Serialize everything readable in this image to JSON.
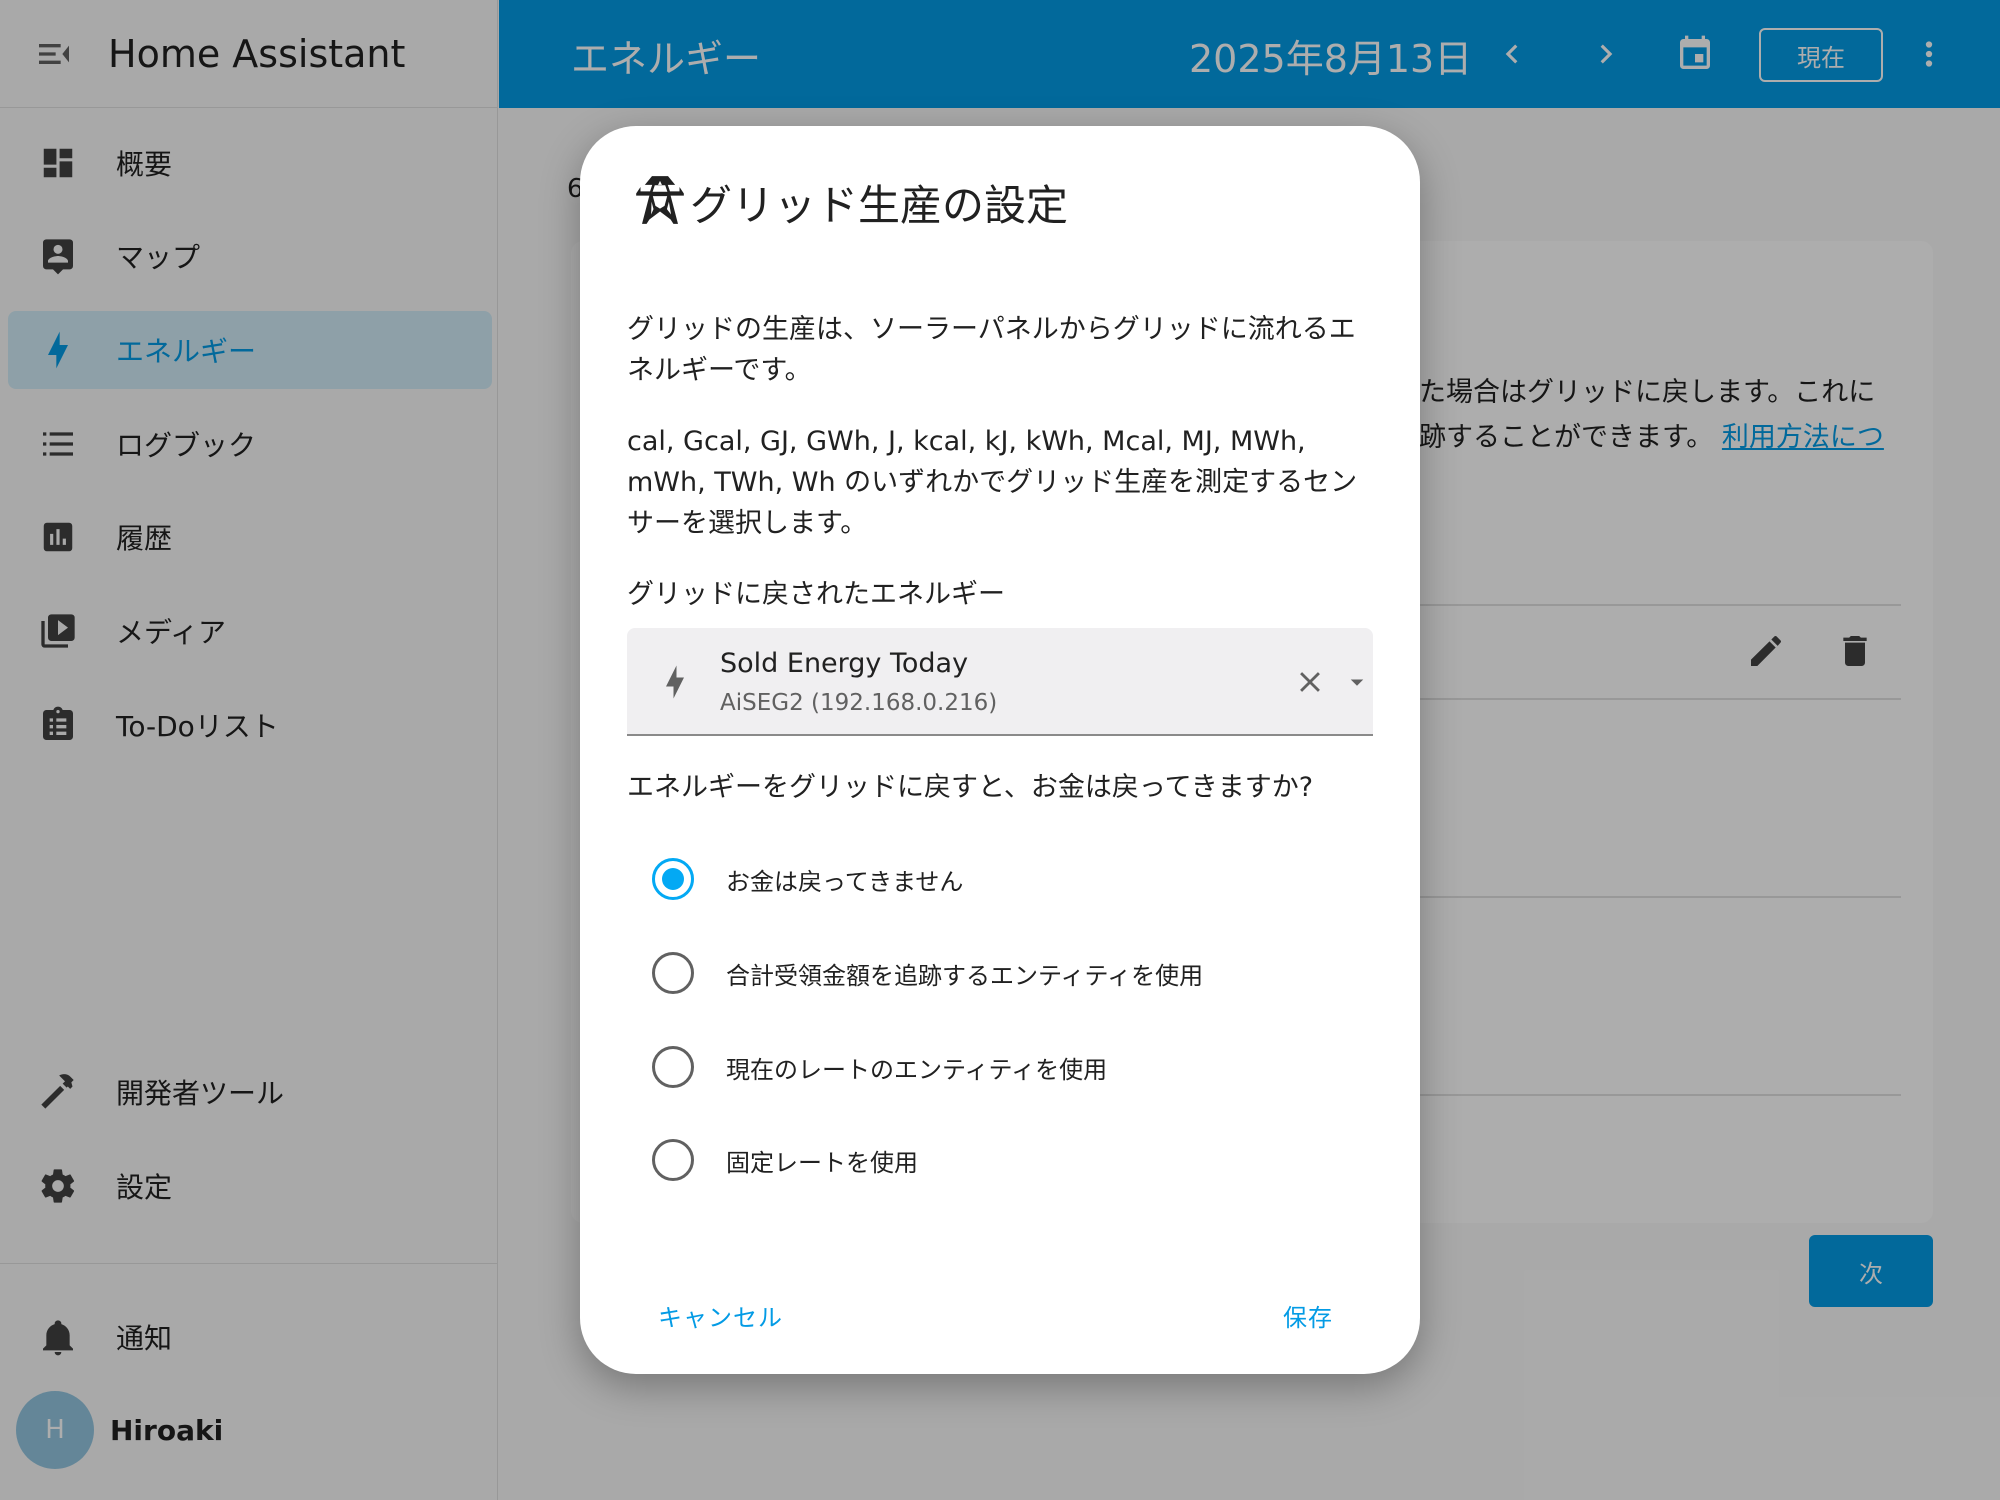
{
  "sidebar": {
    "title": "Home Assistant",
    "items": [
      {
        "label": "概要",
        "icon": "dashboard-icon"
      },
      {
        "label": "マップ",
        "icon": "map-account-icon"
      },
      {
        "label": "エネルギー",
        "icon": "lightning-bolt-icon",
        "active": true
      },
      {
        "label": "ログブック",
        "icon": "format-list-icon"
      },
      {
        "label": "履歴",
        "icon": "chart-box-icon"
      },
      {
        "label": "メディア",
        "icon": "play-box-multiple-icon"
      },
      {
        "label": "To-Doリスト",
        "icon": "clipboard-list-icon"
      },
      {
        "label": "開発者ツール",
        "icon": "hammer-icon"
      },
      {
        "label": "設定",
        "icon": "gear-icon"
      },
      {
        "label": "通知",
        "icon": "bell-icon"
      }
    ],
    "user": {
      "initial": "H",
      "name": "Hiroaki"
    }
  },
  "topbar": {
    "title": "エネルギー",
    "date": "2025年8月13日",
    "now_label": "現在"
  },
  "background": {
    "step_fragment": "6",
    "line1": "た場合はグリッドに戻します。これに",
    "line2_prefix": "跡することができます。",
    "line2_link": "利用方法につ",
    "next_label": "次"
  },
  "dialog": {
    "title": "グリッド生産の設定",
    "paragraph1": "グリッドの生産は、ソーラーパネルからグリッドに流れるエネルギーです。",
    "paragraph2": "cal, Gcal, GJ, GWh, J, kcal, kJ, kWh, Mcal, MJ, MWh, mWh, TWh, Wh のいずれかでグリッド生産を測定するセンサーを選択します。",
    "sensor_label": "グリッドに戻されたエネルギー",
    "sensor": {
      "name": "Sold Energy Today",
      "device": "AiSEG2 (192.168.0.216)"
    },
    "question": "エネルギーをグリッドに戻すと、お金は戻ってきますか?",
    "options": [
      {
        "label": "お金は戻ってきません",
        "checked": true
      },
      {
        "label": "合計受領金額を追跡するエンティティを使用",
        "checked": false
      },
      {
        "label": "現在のレートのエンティティを使用",
        "checked": false
      },
      {
        "label": "固定レートを使用",
        "checked": false
      }
    ],
    "cancel_label": "キャンセル",
    "save_label": "保存"
  },
  "colors": {
    "primary": "#039be5",
    "radio_checked": "#03a9f4",
    "scrim": "rgba(0,0,0,0.32)"
  }
}
